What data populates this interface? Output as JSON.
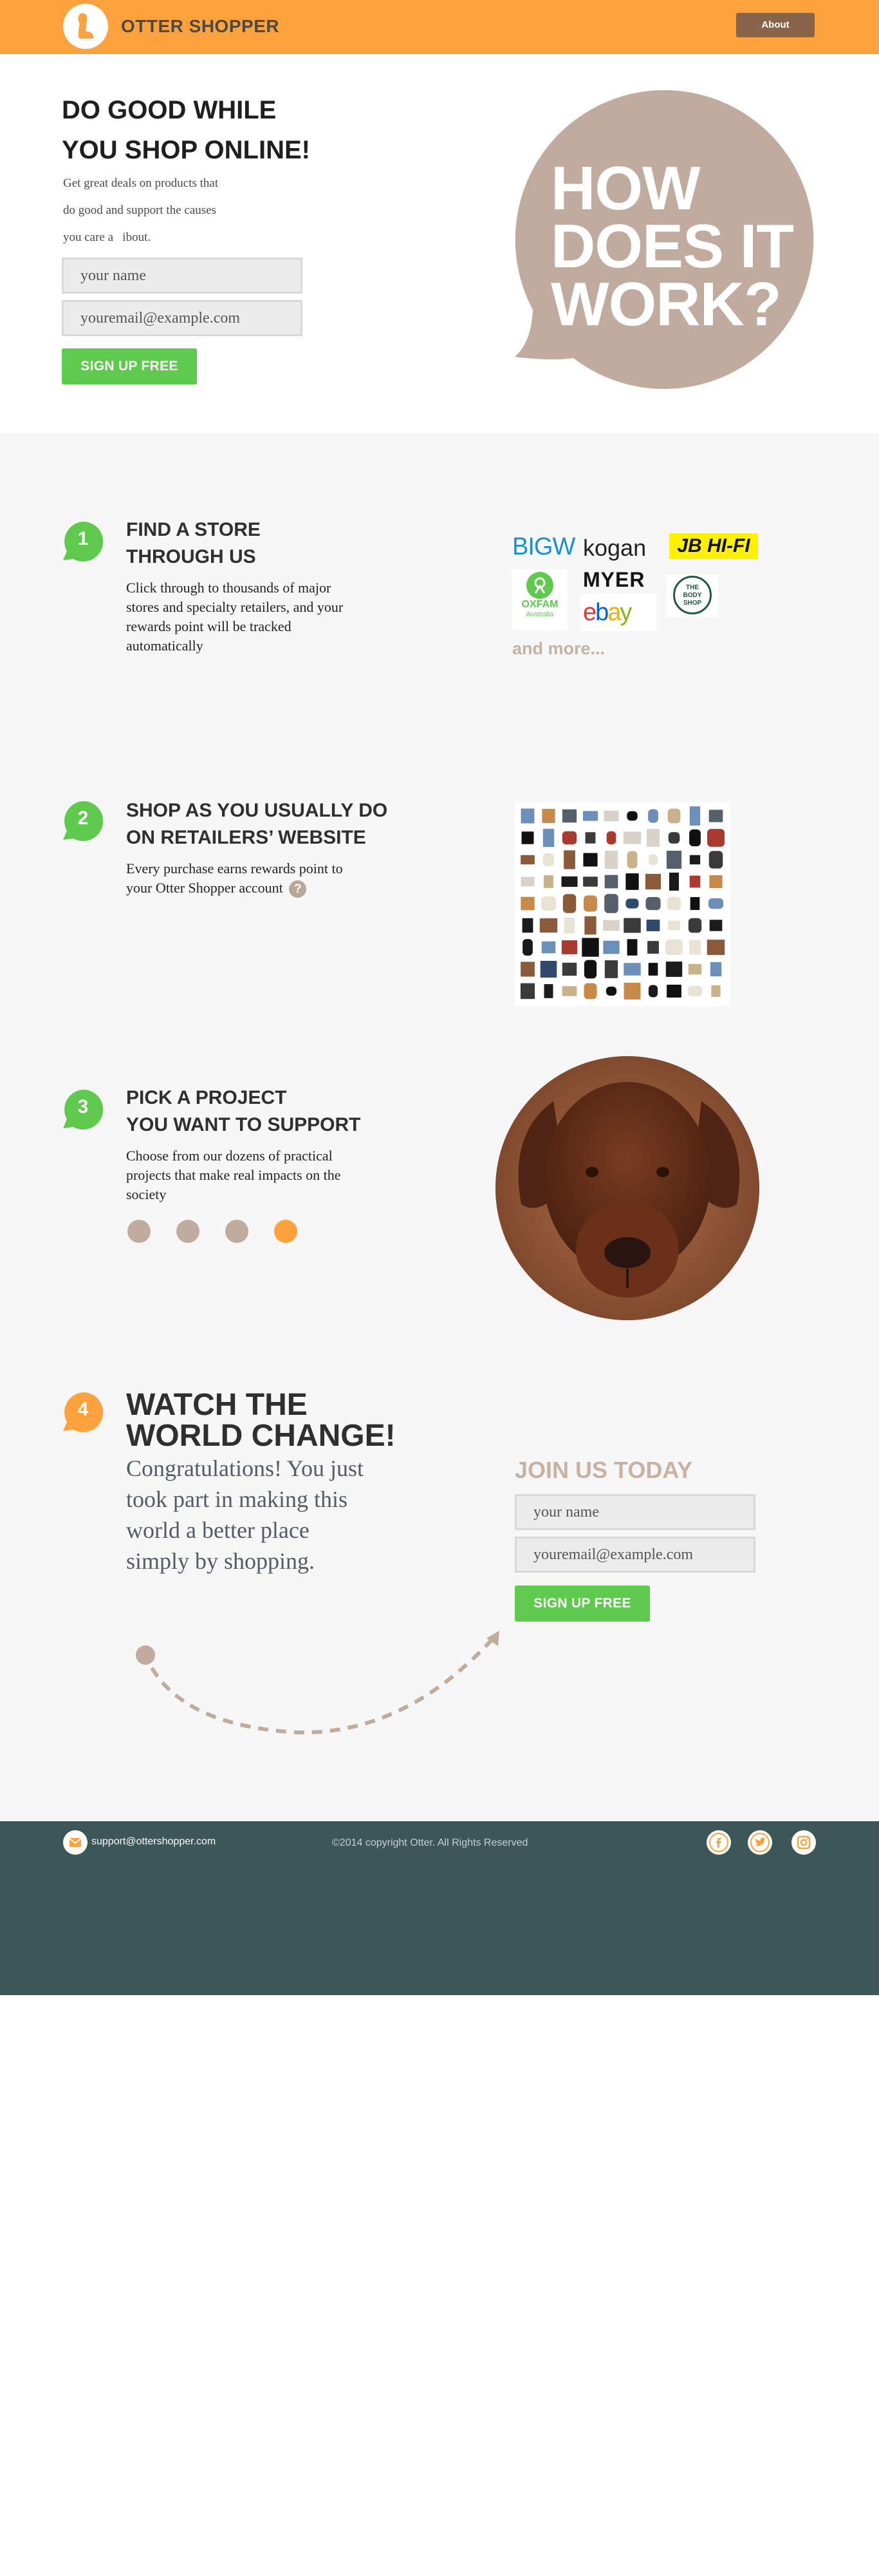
{
  "header": {
    "brand": "OTTER SHOPPER",
    "about_label": "About",
    "colors": {
      "bar": "#fda23d",
      "about_bg": "#8a6449"
    }
  },
  "hero": {
    "title_line1": "DO GOOD WHILE",
    "title_line2": "YOU SHOP ONLINE!",
    "text_line1": "Get great deals on products that",
    "text_line2": "do good and support the causes",
    "text_line3": "you care a   ibout.",
    "name_placeholder": "your name",
    "email_placeholder": "youremail@example.com",
    "signup_label": "SIGN UP FREE",
    "bubble_line1": "HOW",
    "bubble_line2": "DOES IT",
    "bubble_line3": "WORK?"
  },
  "steps": [
    {
      "number": "1",
      "title_line1": "FIND A STORE",
      "title_line2": "THROUGH US",
      "text": "Click through to thousands of major stores and specialty retailers, and your rewards point will be tracked automatically"
    },
    {
      "number": "2",
      "title_line1": "SHOP AS YOU USUALLY DO",
      "title_line2": "ON RETAILERS’ WEBSITE",
      "text": "Every purchase earns rewards point to your Otter Shopper account",
      "help_glyph": "?"
    },
    {
      "number": "3",
      "title_line1": "PICK A PROJECT",
      "title_line2": "YOU WANT TO SUPPORT",
      "text": "Choose from our dozens of practical projects that make real impacts on the society",
      "carousel_active_index": 3,
      "carousel_count": 4
    },
    {
      "number": "4",
      "title_line1": "WATCH THE",
      "title_line2": "WORLD CHANGE!",
      "text": "Congratulations! You just took part in making this world a better place simply by shopping."
    }
  ],
  "stores": {
    "bigw": "BIGW",
    "kogan": "kogan",
    "jbhifi": "JB HI-FI",
    "oxfam": "OXFAM",
    "oxfam_sub": "Australia",
    "myer": "MYER",
    "body_shop_1": "THE",
    "body_shop_2": "BODY",
    "body_shop_3": "SHOP",
    "ebay_e": "e",
    "ebay_b": "b",
    "ebay_a": "a",
    "ebay_y": "y",
    "and_more": "and more..."
  },
  "join": {
    "title": "JOIN US TODAY",
    "name_placeholder": "your name",
    "email_placeholder": "youremail@example.com",
    "signup_label": "SIGN UP FREE"
  },
  "footer": {
    "email": "support@ottershopper.com",
    "copyright": "©2014 copyright Otter. All Rights Reserved",
    "icons": [
      "mail-icon",
      "facebook-icon",
      "twitter-icon",
      "instagram-icon"
    ]
  },
  "colors": {
    "orange": "#fda23d",
    "green": "#5ec94d",
    "taupe": "#c0ab9e",
    "footer": "#3d5658"
  }
}
